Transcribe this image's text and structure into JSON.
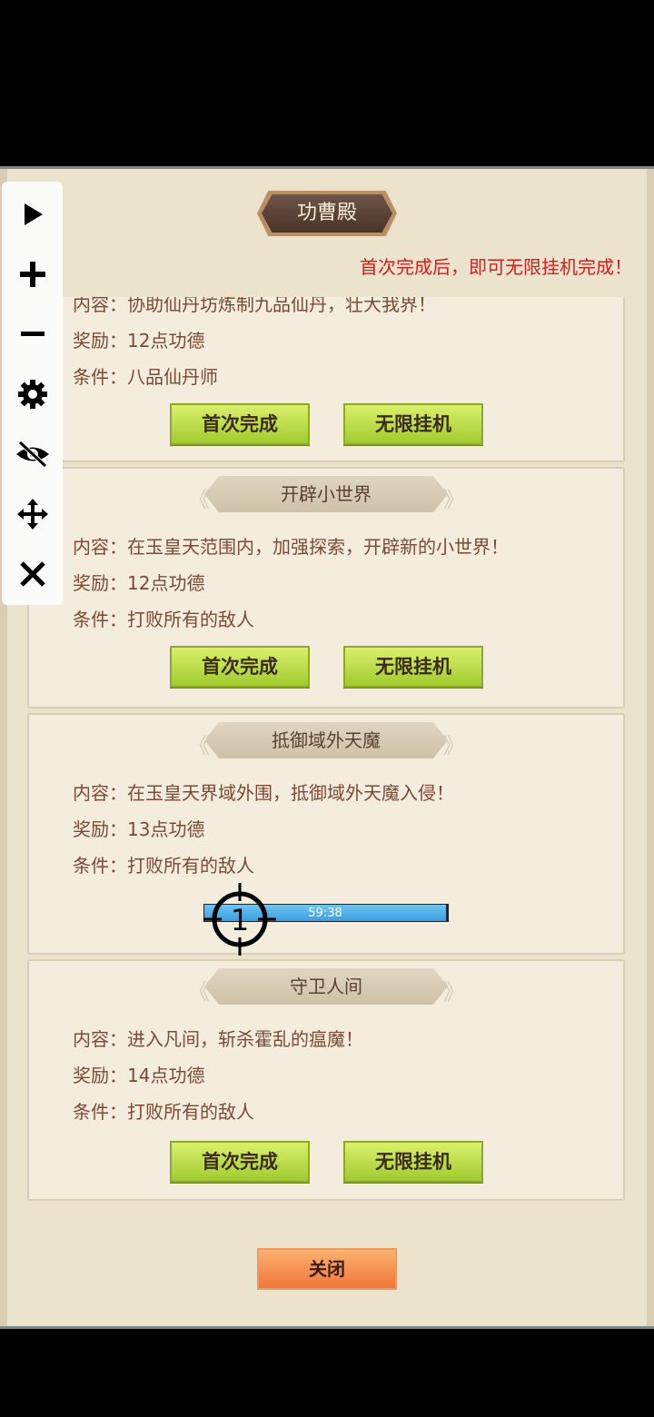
{
  "dialog": {
    "title": "功曹殿",
    "notice": "首次完成后，即可无限挂机完成！",
    "close_label": "关闭"
  },
  "tasks": [
    {
      "content": "内容：协助仙丹坊炼制九品仙丹，壮大我界！",
      "reward": "奖励：12点功德",
      "condition": "条件：八品仙丹师",
      "first_label": "首次完成",
      "idle_label": "无限挂机"
    },
    {
      "name": "开辟小世界",
      "content": "内容：在玉皇天范围内，加强探索，开辟新的小世界！",
      "reward": "奖励：12点功德",
      "condition": "条件：打败所有的敌人",
      "first_label": "首次完成",
      "idle_label": "无限挂机"
    },
    {
      "name": "抵御域外天魔",
      "content": "内容：在玉皇天界域外围，抵御域外天魔入侵！",
      "reward": "奖励：13点功德",
      "condition": "条件：打败所有的敌人",
      "timer": "59:38",
      "timer_progress": 1.0,
      "target_count": "1"
    },
    {
      "name": "守卫人间",
      "content": "内容：进入凡间，斩杀霍乱的瘟魔！",
      "reward": "奖励：14点功德",
      "condition": "条件：打败所有的敌人",
      "first_label": "首次完成",
      "idle_label": "无限挂机"
    }
  ],
  "toolbar": {
    "items": [
      "play-icon",
      "plus-icon",
      "minus-icon",
      "gear-icon",
      "eye-off-icon",
      "move-icon",
      "close-icon"
    ]
  },
  "colors": {
    "notice": "#d21e1e",
    "button_green": "#b8dd45",
    "button_orange": "#f49255",
    "timer_blue": "#4aaeea"
  }
}
